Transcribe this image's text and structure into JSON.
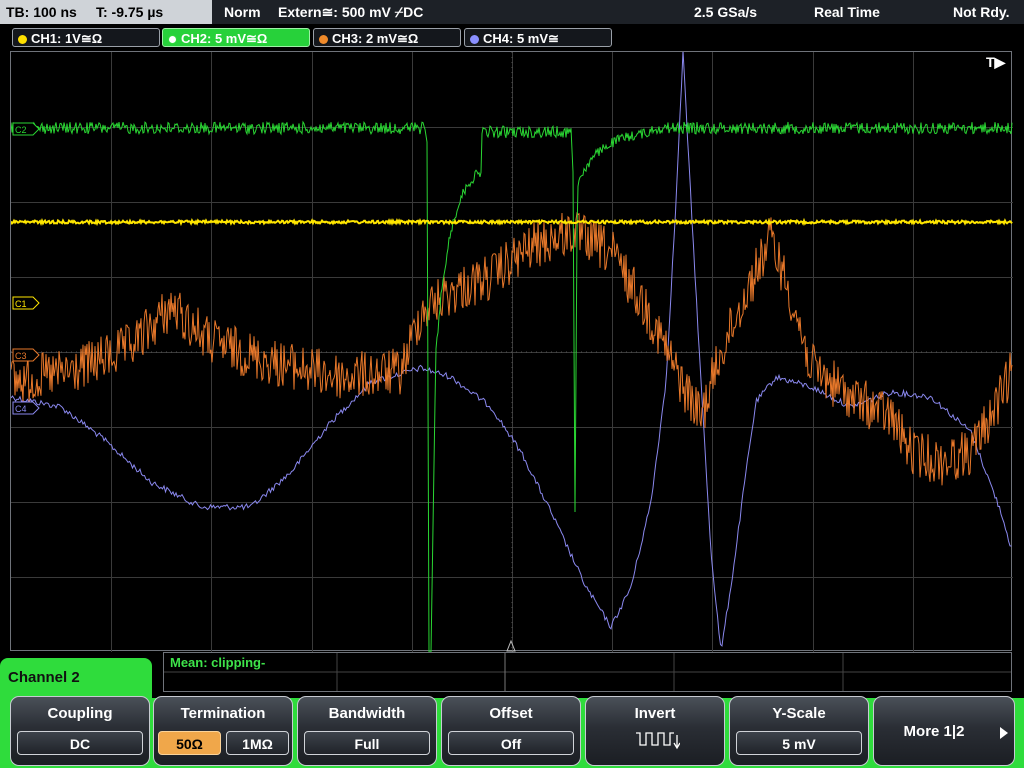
{
  "status_bar": {
    "timebase": "TB: 100 ns",
    "trigger_time": "T: -9.75 µs",
    "trigger_mode": "Norm",
    "trigger_source": "Extern≅: 500 mV ⌿DC",
    "sample_rate": "2.5 GSa/s",
    "acq_mode": "Real Time",
    "acq_state": "Not Rdy."
  },
  "channel_tabs": [
    {
      "label": "CH1: 1V≅Ω",
      "color": "#ffe000",
      "active": false
    },
    {
      "label": "CH2: 5 mV≅Ω",
      "color": "#2fdc3c",
      "active": true
    },
    {
      "label": "CH3: 2 mV≅Ω",
      "color": "#f08a2a",
      "active": false
    },
    {
      "label": "CH4: 5 mV≅",
      "color": "#8a8fff",
      "active": false
    }
  ],
  "screen": {
    "trigger_marker": "T▶",
    "channel_markers": [
      "C1",
      "C2",
      "C3",
      "C4"
    ],
    "channel_colors": {
      "ch1": "#ffe600",
      "ch2": "#2ad633",
      "ch3": "#e8782a",
      "ch4": "#8a88ee"
    }
  },
  "measurement": {
    "text": "Mean: clipping-"
  },
  "menu": {
    "title": "Channel 2",
    "softkeys": [
      {
        "title": "Coupling",
        "values": [
          "DC"
        ],
        "selected": 0
      },
      {
        "title": "Termination",
        "values": [
          "50Ω",
          "1MΩ"
        ],
        "selected": 0
      },
      {
        "title": "Bandwidth",
        "values": [
          "Full"
        ],
        "selected": -1
      },
      {
        "title": "Offset",
        "values": [
          "Off"
        ],
        "selected": -1
      },
      {
        "title": "Invert",
        "icon": "invert-wave-icon"
      },
      {
        "title": "Y-Scale",
        "values": [
          "5 mV"
        ],
        "selected": -1
      },
      {
        "title": "More 1|2",
        "icon": "next-arrow-icon"
      }
    ]
  }
}
